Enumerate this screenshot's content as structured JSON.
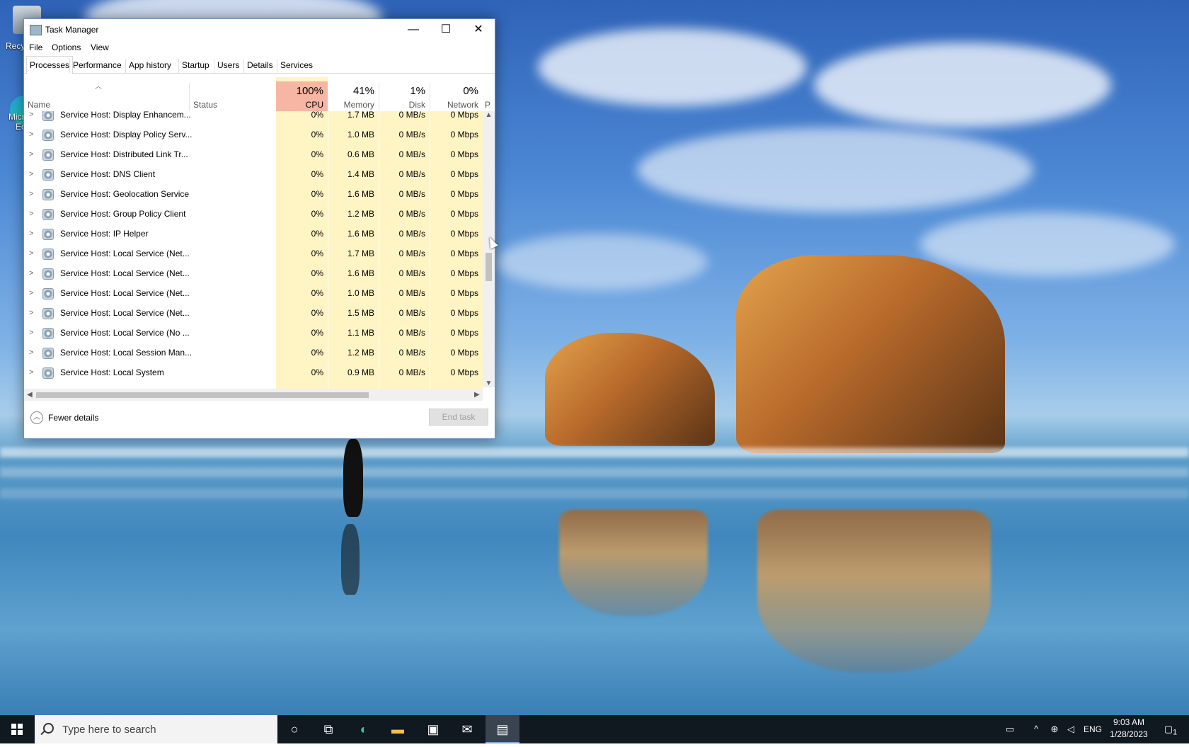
{
  "desktop": {
    "icons": [
      {
        "label": "Recy"
      },
      {
        "label": "Micr"
      },
      {
        "label": "Ec"
      }
    ]
  },
  "window": {
    "title": "Task Manager",
    "controls": {
      "minimize": "—",
      "maximize": "☐",
      "close": "✕"
    }
  },
  "menu": [
    "File",
    "Options",
    "View"
  ],
  "tabs": [
    "Processes",
    "Performance",
    "App history",
    "Startup",
    "Users",
    "Details",
    "Services"
  ],
  "active_tab": "Processes",
  "columns": {
    "name": "Name",
    "status": "Status",
    "cpu": {
      "pct": "100%",
      "label": "CPU"
    },
    "memory": {
      "pct": "41%",
      "label": "Memory"
    },
    "disk": {
      "pct": "1%",
      "label": "Disk"
    },
    "network": {
      "pct": "0%",
      "label": "Network"
    },
    "overflow": "P"
  },
  "processes": [
    {
      "name": "Service Host: Display Enhancem...",
      "cpu": "0%",
      "memory": "1.7 MB",
      "disk": "0 MB/s",
      "network": "0 Mbps"
    },
    {
      "name": "Service Host: Display Policy Serv...",
      "cpu": "0%",
      "memory": "1.0 MB",
      "disk": "0 MB/s",
      "network": "0 Mbps"
    },
    {
      "name": "Service Host: Distributed Link Tr...",
      "cpu": "0%",
      "memory": "0.6 MB",
      "disk": "0 MB/s",
      "network": "0 Mbps"
    },
    {
      "name": "Service Host: DNS Client",
      "cpu": "0%",
      "memory": "1.4 MB",
      "disk": "0 MB/s",
      "network": "0 Mbps"
    },
    {
      "name": "Service Host: Geolocation Service",
      "cpu": "0%",
      "memory": "1.6 MB",
      "disk": "0 MB/s",
      "network": "0 Mbps"
    },
    {
      "name": "Service Host: Group Policy Client",
      "cpu": "0%",
      "memory": "1.2 MB",
      "disk": "0 MB/s",
      "network": "0 Mbps"
    },
    {
      "name": "Service Host: IP Helper",
      "cpu": "0%",
      "memory": "1.6 MB",
      "disk": "0 MB/s",
      "network": "0 Mbps"
    },
    {
      "name": "Service Host: Local Service (Net...",
      "cpu": "0%",
      "memory": "1.7 MB",
      "disk": "0 MB/s",
      "network": "0 Mbps"
    },
    {
      "name": "Service Host: Local Service (Net...",
      "cpu": "0%",
      "memory": "1.6 MB",
      "disk": "0 MB/s",
      "network": "0 Mbps"
    },
    {
      "name": "Service Host: Local Service (Net...",
      "cpu": "0%",
      "memory": "1.0 MB",
      "disk": "0 MB/s",
      "network": "0 Mbps"
    },
    {
      "name": "Service Host: Local Service (Net...",
      "cpu": "0%",
      "memory": "1.5 MB",
      "disk": "0 MB/s",
      "network": "0 Mbps"
    },
    {
      "name": "Service Host: Local Service (No ...",
      "cpu": "0%",
      "memory": "1.1 MB",
      "disk": "0 MB/s",
      "network": "0 Mbps"
    },
    {
      "name": "Service Host: Local Session Man...",
      "cpu": "0%",
      "memory": "1.2 MB",
      "disk": "0 MB/s",
      "network": "0 Mbps"
    },
    {
      "name": "Service Host: Local System",
      "cpu": "0%",
      "memory": "0.9 MB",
      "disk": "0 MB/s",
      "network": "0 Mbps"
    }
  ],
  "footer": {
    "fewer_details": "Fewer details",
    "end_task": "End task"
  },
  "taskbar": {
    "search_placeholder": "Type here to search",
    "pinned": [
      "cortana-icon",
      "task-view-icon",
      "edge-icon",
      "file-explorer-icon",
      "store-icon",
      "mail-icon",
      "task-manager-icon"
    ],
    "tray_lang": "ENG",
    "time": "9:03 AM",
    "date": "1/28/2023",
    "notification_count": "1"
  }
}
